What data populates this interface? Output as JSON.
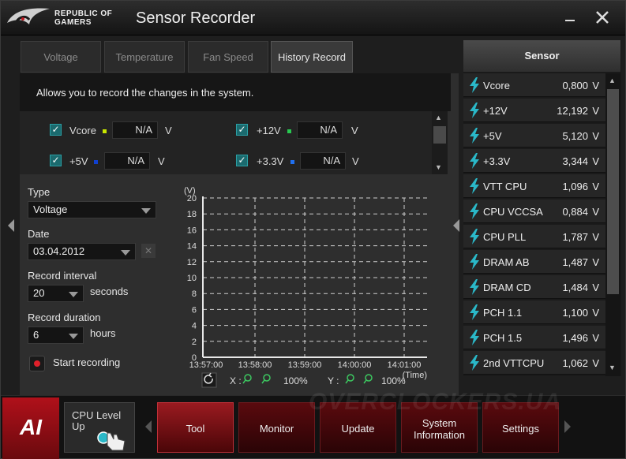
{
  "app": {
    "brand_line1": "REPUBLIC OF",
    "brand_line2": "GAMERS",
    "title": "Sensor Recorder"
  },
  "tabs": [
    {
      "label": "Voltage"
    },
    {
      "label": "Temperature"
    },
    {
      "label": "Fan Speed"
    },
    {
      "label": "History Record"
    }
  ],
  "description": "Allows you to record the changes in the system.",
  "record_sensors": [
    {
      "label": "Vcore",
      "value": "N/A",
      "unit": "V",
      "color": "#c8e600"
    },
    {
      "label": "+12V",
      "value": "N/A",
      "unit": "V",
      "color": "#28c850"
    },
    {
      "label": "+5V",
      "value": "N/A",
      "unit": "V",
      "color": "#1040d0"
    },
    {
      "label": "+3.3V",
      "value": "N/A",
      "unit": "V",
      "color": "#2070f0"
    }
  ],
  "form": {
    "type_label": "Type",
    "type_value": "Voltage",
    "date_label": "Date",
    "date_value": "03.04.2012",
    "interval_label": "Record interval",
    "interval_value": "20",
    "interval_unit": "seconds",
    "duration_label": "Record duration",
    "duration_value": "6",
    "duration_unit": "hours",
    "start_label": "Start recording"
  },
  "chart_data": {
    "type": "line",
    "ylabel": "(V)",
    "xlabel": "(Time)",
    "ylim": [
      0,
      20
    ],
    "yticks": [
      "20",
      "18",
      "16",
      "14",
      "12",
      "10",
      "8",
      "6",
      "4",
      "2",
      "0"
    ],
    "xticks": [
      "13:57:00",
      "13:58:00",
      "13:59:00",
      "14:00:00",
      "14:01:00"
    ],
    "series": [],
    "grid": true
  },
  "zoom": {
    "x_label": "X :",
    "x_value": "100%",
    "y_label": "Y :",
    "y_value": "100%"
  },
  "sensor_panel": {
    "header": "Sensor",
    "items": [
      {
        "name": "Vcore",
        "value": "0,800",
        "unit": "V"
      },
      {
        "name": "+12V",
        "value": "12,192",
        "unit": "V"
      },
      {
        "name": "+5V",
        "value": "5,120",
        "unit": "V"
      },
      {
        "name": "+3.3V",
        "value": "3,344",
        "unit": "V"
      },
      {
        "name": "VTT CPU",
        "value": "1,096",
        "unit": "V"
      },
      {
        "name": "CPU VCCSA",
        "value": "0,884",
        "unit": "V"
      },
      {
        "name": "CPU PLL",
        "value": "1,787",
        "unit": "V"
      },
      {
        "name": "DRAM AB",
        "value": "1,487",
        "unit": "V"
      },
      {
        "name": "DRAM CD",
        "value": "1,484",
        "unit": "V"
      },
      {
        "name": "PCH 1.1",
        "value": "1,100",
        "unit": "V"
      },
      {
        "name": "PCH 1.5",
        "value": "1,496",
        "unit": "V"
      },
      {
        "name": "2nd VTTCPU",
        "value": "1,062",
        "unit": "V"
      }
    ]
  },
  "bottom": {
    "cpu_level_label": "CPU Level Up",
    "nav": [
      {
        "label": "Tool"
      },
      {
        "label": "Monitor"
      },
      {
        "label": "Update"
      },
      {
        "label": "System Information"
      },
      {
        "label": "Settings"
      }
    ],
    "watermark": "OVERCLOCKERS.UA"
  },
  "colors": {
    "accent": "#b0101a",
    "check": "#1b6a6e",
    "bolt": "#2ab8c8"
  }
}
